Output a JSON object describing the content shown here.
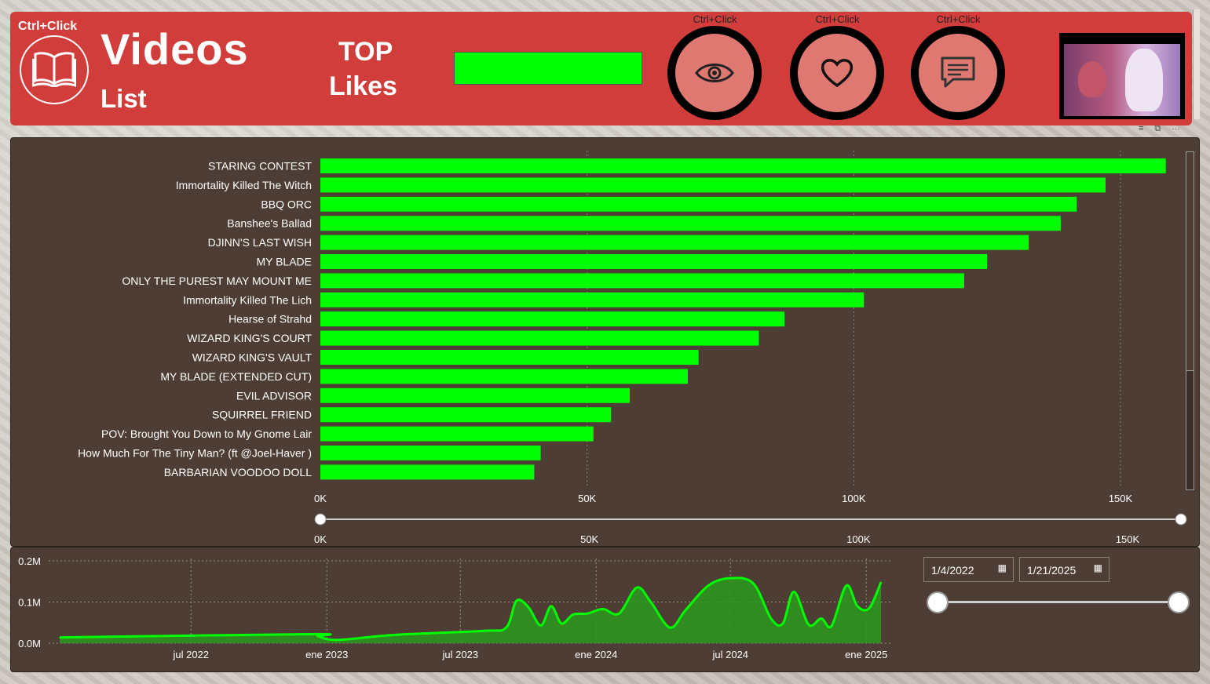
{
  "header": {
    "ctrl_click_label": "Ctrl+Click",
    "title": "Videos",
    "subtitle": "List",
    "top_label": "TOP",
    "metric_label": "Likes",
    "nav_buttons": [
      {
        "ctrl_label": "Ctrl+Click",
        "icon": "eye-icon"
      },
      {
        "ctrl_label": "Ctrl+Click",
        "icon": "heart-icon"
      },
      {
        "ctrl_label": "Ctrl+Click",
        "icon": "comment-icon"
      }
    ],
    "colors": {
      "header_bg": "#d13d3a",
      "accent": "#00ff00",
      "ring": "#000000"
    }
  },
  "chart_data": [
    {
      "type": "bar",
      "orientation": "horizontal",
      "categories": [
        "STARING CONTEST",
        "Immortality Killed The Witch",
        "BBQ ORC",
        "Banshee's Ballad",
        "DJINN'S LAST WISH",
        "MY BLADE",
        "ONLY THE PUREST MAY MOUNT ME",
        "Immortality Killed The Lich",
        "Hearse of Strahd",
        "WIZARD KING'S COURT",
        "WIZARD KING'S VAULT",
        "MY BLADE (EXTENDED CUT)",
        "EVIL ADVISOR",
        "SQUIRREL FRIEND",
        "POV: Brought You Down to My Gnome Lair",
        "How Much For The Tiny Man? (ft @Joel-Haver )",
        "BARBARIAN VOODOO DOLL"
      ],
      "values": [
        158500,
        147200,
        141800,
        138800,
        132800,
        125000,
        120700,
        101900,
        87000,
        82200,
        70900,
        68900,
        58000,
        54500,
        51200,
        41300,
        40100
      ],
      "xlim": [
        0,
        160000
      ],
      "x_ticks": [
        "0K",
        "50K",
        "100K",
        "150K"
      ],
      "x_tick_values": [
        0,
        50000,
        100000,
        150000
      ],
      "grid": "vertical dotted",
      "bar_color": "#00ff00",
      "range_slider_ticks": [
        "0K",
        "50K",
        "100K",
        "150K"
      ]
    },
    {
      "type": "area",
      "x": [
        "2022-01-04",
        "2022-12-10",
        "2022-12-20",
        "2023-01-15",
        "2023-04-01",
        "2023-08-01",
        "2023-09-01",
        "2023-09-15",
        "2023-10-01",
        "2023-10-18",
        "2023-11-01",
        "2023-11-15",
        "2023-12-01",
        "2023-12-20",
        "2024-01-10",
        "2024-02-01",
        "2024-02-25",
        "2024-03-15",
        "2024-04-10",
        "2024-05-01",
        "2024-06-01",
        "2024-07-01",
        "2024-08-01",
        "2024-08-25",
        "2024-09-10",
        "2024-09-25",
        "2024-10-15",
        "2024-11-01",
        "2024-11-15",
        "2024-12-05",
        "2024-12-20",
        "2025-01-05",
        "2025-01-21"
      ],
      "values": [
        14000,
        22000,
        17000,
        8000,
        20000,
        30000,
        38000,
        103000,
        88000,
        43000,
        90000,
        48000,
        70000,
        72000,
        83000,
        72000,
        135000,
        100000,
        38000,
        80000,
        140000,
        158000,
        145000,
        60000,
        48000,
        125000,
        45000,
        60000,
        42000,
        140000,
        90000,
        85000,
        148000
      ],
      "ylim": [
        0,
        200000
      ],
      "y_ticks": [
        "0.0M",
        "0.1M",
        "0.2M"
      ],
      "x_ticks": [
        "jul 2022",
        "ene 2023",
        "jul 2023",
        "ene 2024",
        "jul 2024",
        "ene 2025"
      ],
      "line_color": "#00ff00",
      "fill_color": "#2b9a1f"
    }
  ],
  "date_filter": {
    "start": "1/4/2022",
    "end": "1/21/2025",
    "calendar_icon": "calendar-icon"
  }
}
